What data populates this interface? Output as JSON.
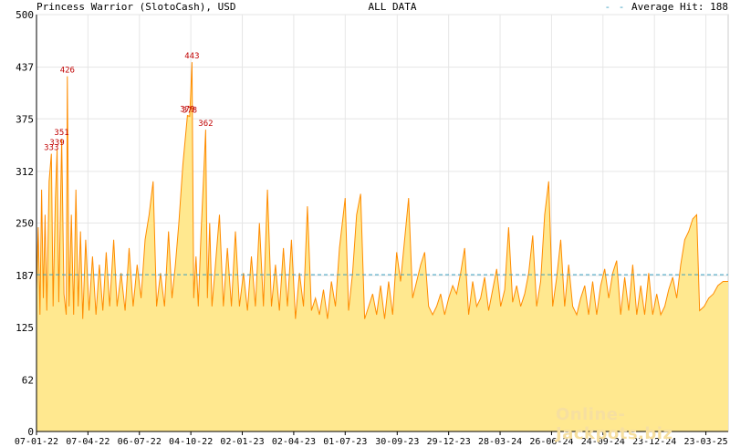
{
  "header": {
    "title": "Princess Warrior (SlotoCash), USD",
    "center": "ALL DATA",
    "legend_prefix": "- -",
    "legend_label": "Average Hit: 188"
  },
  "watermark": "Online-Jackpots.biz",
  "colors": {
    "line": "#ff8c00",
    "fill": "#ffe88f",
    "grid": "#e6e6e6",
    "average_line": "#3a9fc0",
    "peak_label": "#c00000",
    "axis": "#000000"
  },
  "chart_data": {
    "type": "area",
    "title": "Princess Warrior (SlotoCash), USD",
    "subtitle": "ALL DATA",
    "xlabel": "",
    "ylabel": "",
    "ylim": [
      0,
      500
    ],
    "xlim": [
      "2022-01-07",
      "2025-05-01"
    ],
    "grid": true,
    "y_ticks": [
      0,
      62,
      125,
      187,
      250,
      312,
      375,
      437,
      500
    ],
    "x_ticks": [
      "07-01-22",
      "07-04-22",
      "06-07-22",
      "04-10-22",
      "02-01-23",
      "02-04-23",
      "01-07-23",
      "30-09-23",
      "29-12-23",
      "28-03-24",
      "26-06-24",
      "24-09-24",
      "23-12-24",
      "23-03-25"
    ],
    "average": {
      "label": "Average Hit: 188",
      "value": 188
    },
    "peaks": [
      {
        "date": "2022-02-02",
        "value": 333,
        "label": "333"
      },
      {
        "date": "2022-02-12",
        "value": 339,
        "label": "339"
      },
      {
        "date": "2022-02-20",
        "value": 351,
        "label": "351"
      },
      {
        "date": "2022-03-02",
        "value": 426,
        "label": "426"
      },
      {
        "date": "2022-09-28",
        "value": 379,
        "label": "379"
      },
      {
        "date": "2022-10-02",
        "value": 378,
        "label": "378"
      },
      {
        "date": "2022-10-06",
        "value": 443,
        "label": "443"
      },
      {
        "date": "2022-10-30",
        "value": 362,
        "label": "362"
      }
    ],
    "series": [
      {
        "values": [
          [
            "2022-01-07",
            170
          ],
          [
            "2022-01-10",
            245
          ],
          [
            "2022-01-13",
            140
          ],
          [
            "2022-01-16",
            290
          ],
          [
            "2022-01-19",
            160
          ],
          [
            "2022-01-22",
            260
          ],
          [
            "2022-01-25",
            145
          ],
          [
            "2022-01-29",
            300
          ],
          [
            "2022-02-02",
            333
          ],
          [
            "2022-02-05",
            150
          ],
          [
            "2022-02-09",
            280
          ],
          [
            "2022-02-12",
            339
          ],
          [
            "2022-02-15",
            155
          ],
          [
            "2022-02-20",
            351
          ],
          [
            "2022-02-24",
            165
          ],
          [
            "2022-02-28",
            140
          ],
          [
            "2022-03-02",
            426
          ],
          [
            "2022-03-05",
            150
          ],
          [
            "2022-03-09",
            260
          ],
          [
            "2022-03-13",
            140
          ],
          [
            "2022-03-17",
            290
          ],
          [
            "2022-03-21",
            150
          ],
          [
            "2022-03-25",
            240
          ],
          [
            "2022-03-29",
            135
          ],
          [
            "2022-04-03",
            230
          ],
          [
            "2022-04-09",
            145
          ],
          [
            "2022-04-15",
            210
          ],
          [
            "2022-04-21",
            140
          ],
          [
            "2022-04-27",
            200
          ],
          [
            "2022-05-03",
            145
          ],
          [
            "2022-05-09",
            215
          ],
          [
            "2022-05-15",
            150
          ],
          [
            "2022-05-22",
            230
          ],
          [
            "2022-05-28",
            150
          ],
          [
            "2022-06-04",
            190
          ],
          [
            "2022-06-11",
            145
          ],
          [
            "2022-06-18",
            220
          ],
          [
            "2022-06-25",
            150
          ],
          [
            "2022-07-02",
            200
          ],
          [
            "2022-07-09",
            160
          ],
          [
            "2022-07-16",
            230
          ],
          [
            "2022-07-23",
            260
          ],
          [
            "2022-07-30",
            300
          ],
          [
            "2022-08-05",
            150
          ],
          [
            "2022-08-12",
            190
          ],
          [
            "2022-08-19",
            150
          ],
          [
            "2022-08-26",
            240
          ],
          [
            "2022-09-01",
            160
          ],
          [
            "2022-09-07",
            200
          ],
          [
            "2022-09-13",
            250
          ],
          [
            "2022-09-20",
            320
          ],
          [
            "2022-09-28",
            379
          ],
          [
            "2022-10-02",
            378
          ],
          [
            "2022-10-06",
            443
          ],
          [
            "2022-10-09",
            160
          ],
          [
            "2022-10-13",
            210
          ],
          [
            "2022-10-17",
            150
          ],
          [
            "2022-10-22",
            240
          ],
          [
            "2022-10-26",
            300
          ],
          [
            "2022-10-30",
            362
          ],
          [
            "2022-11-02",
            160
          ],
          [
            "2022-11-06",
            250
          ],
          [
            "2022-11-10",
            150
          ],
          [
            "2022-11-16",
            200
          ],
          [
            "2022-11-23",
            260
          ],
          [
            "2022-11-30",
            150
          ],
          [
            "2022-12-07",
            220
          ],
          [
            "2022-12-14",
            150
          ],
          [
            "2022-12-21",
            240
          ],
          [
            "2022-12-28",
            150
          ],
          [
            "2023-01-04",
            190
          ],
          [
            "2023-01-11",
            145
          ],
          [
            "2023-01-18",
            210
          ],
          [
            "2023-01-25",
            150
          ],
          [
            "2023-02-01",
            250
          ],
          [
            "2023-02-08",
            150
          ],
          [
            "2023-02-15",
            290
          ],
          [
            "2023-02-22",
            150
          ],
          [
            "2023-03-01",
            200
          ],
          [
            "2023-03-08",
            145
          ],
          [
            "2023-03-15",
            220
          ],
          [
            "2023-03-22",
            150
          ],
          [
            "2023-03-29",
            230
          ],
          [
            "2023-04-05",
            135
          ],
          [
            "2023-04-12",
            190
          ],
          [
            "2023-04-19",
            150
          ],
          [
            "2023-04-26",
            270
          ],
          [
            "2023-05-03",
            145
          ],
          [
            "2023-05-10",
            160
          ],
          [
            "2023-05-17",
            140
          ],
          [
            "2023-05-24",
            170
          ],
          [
            "2023-05-31",
            135
          ],
          [
            "2023-06-07",
            180
          ],
          [
            "2023-06-14",
            150
          ],
          [
            "2023-06-21",
            220
          ],
          [
            "2023-07-01",
            280
          ],
          [
            "2023-07-07",
            145
          ],
          [
            "2023-07-14",
            190
          ],
          [
            "2023-07-21",
            260
          ],
          [
            "2023-07-28",
            285
          ],
          [
            "2023-08-04",
            135
          ],
          [
            "2023-08-11",
            150
          ],
          [
            "2023-08-18",
            165
          ],
          [
            "2023-08-25",
            140
          ],
          [
            "2023-09-01",
            175
          ],
          [
            "2023-09-08",
            135
          ],
          [
            "2023-09-15",
            180
          ],
          [
            "2023-09-22",
            140
          ],
          [
            "2023-09-29",
            215
          ],
          [
            "2023-10-06",
            180
          ],
          [
            "2023-10-13",
            230
          ],
          [
            "2023-10-20",
            280
          ],
          [
            "2023-10-27",
            160
          ],
          [
            "2023-11-03",
            180
          ],
          [
            "2023-11-10",
            200
          ],
          [
            "2023-11-17",
            215
          ],
          [
            "2023-11-24",
            150
          ],
          [
            "2023-12-01",
            140
          ],
          [
            "2023-12-08",
            150
          ],
          [
            "2023-12-15",
            165
          ],
          [
            "2023-12-22",
            140
          ],
          [
            "2023-12-29",
            160
          ],
          [
            "2024-01-05",
            175
          ],
          [
            "2024-01-12",
            165
          ],
          [
            "2024-01-19",
            190
          ],
          [
            "2024-01-26",
            220
          ],
          [
            "2024-02-02",
            140
          ],
          [
            "2024-02-09",
            180
          ],
          [
            "2024-02-16",
            150
          ],
          [
            "2024-02-23",
            160
          ],
          [
            "2024-03-01",
            185
          ],
          [
            "2024-03-08",
            145
          ],
          [
            "2024-03-15",
            170
          ],
          [
            "2024-03-22",
            195
          ],
          [
            "2024-03-29",
            150
          ],
          [
            "2024-04-05",
            170
          ],
          [
            "2024-04-12",
            245
          ],
          [
            "2024-04-19",
            155
          ],
          [
            "2024-04-26",
            175
          ],
          [
            "2024-05-03",
            150
          ],
          [
            "2024-05-10",
            165
          ],
          [
            "2024-05-17",
            190
          ],
          [
            "2024-05-24",
            235
          ],
          [
            "2024-05-31",
            150
          ],
          [
            "2024-06-07",
            180
          ],
          [
            "2024-06-14",
            260
          ],
          [
            "2024-06-21",
            300
          ],
          [
            "2024-06-28",
            150
          ],
          [
            "2024-07-05",
            185
          ],
          [
            "2024-07-12",
            230
          ],
          [
            "2024-07-19",
            150
          ],
          [
            "2024-07-26",
            200
          ],
          [
            "2024-08-02",
            150
          ],
          [
            "2024-08-09",
            140
          ],
          [
            "2024-08-16",
            160
          ],
          [
            "2024-08-23",
            175
          ],
          [
            "2024-08-30",
            140
          ],
          [
            "2024-09-06",
            180
          ],
          [
            "2024-09-13",
            140
          ],
          [
            "2024-09-20",
            175
          ],
          [
            "2024-09-27",
            195
          ],
          [
            "2024-10-04",
            160
          ],
          [
            "2024-10-11",
            190
          ],
          [
            "2024-10-18",
            205
          ],
          [
            "2024-10-25",
            140
          ],
          [
            "2024-11-01",
            185
          ],
          [
            "2024-11-08",
            145
          ],
          [
            "2024-11-15",
            200
          ],
          [
            "2024-11-22",
            140
          ],
          [
            "2024-11-29",
            175
          ],
          [
            "2024-12-06",
            140
          ],
          [
            "2024-12-13",
            190
          ],
          [
            "2024-12-20",
            140
          ],
          [
            "2024-12-27",
            165
          ],
          [
            "2025-01-03",
            140
          ],
          [
            "2025-01-10",
            150
          ],
          [
            "2025-01-17",
            170
          ],
          [
            "2025-01-24",
            185
          ],
          [
            "2025-01-31",
            160
          ],
          [
            "2025-02-07",
            200
          ],
          [
            "2025-02-14",
            230
          ],
          [
            "2025-02-21",
            240
          ],
          [
            "2025-02-28",
            255
          ],
          [
            "2025-03-07",
            260
          ],
          [
            "2025-03-12",
            145
          ],
          [
            "2025-03-20",
            150
          ],
          [
            "2025-03-28",
            160
          ],
          [
            "2025-04-05",
            165
          ],
          [
            "2025-04-13",
            175
          ],
          [
            "2025-04-22",
            180
          ],
          [
            "2025-05-01",
            180
          ]
        ]
      }
    ]
  }
}
